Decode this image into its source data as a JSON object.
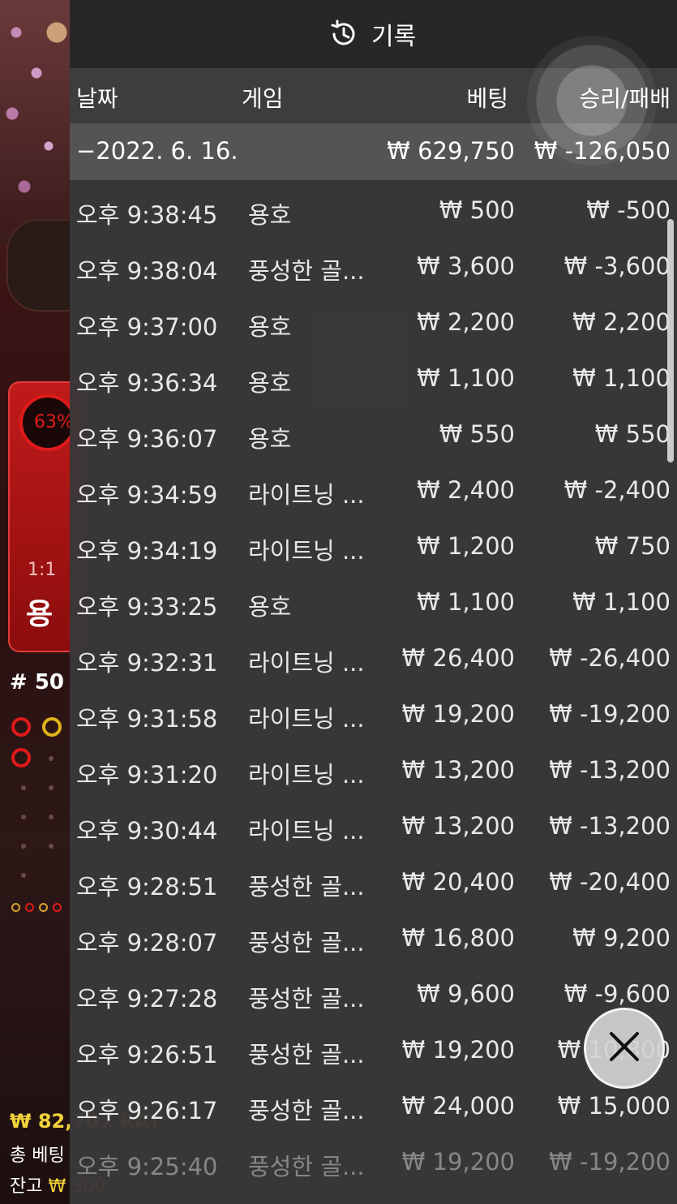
{
  "game_bg": {
    "bet_percent": "63%",
    "odds": "1:1",
    "side_label": "용",
    "round": "# 50",
    "balance": "₩ 82,707 RAT",
    "total_bet_label": "총 베팅",
    "remaining_label": "잔고",
    "remaining_value": "₩ 300"
  },
  "header": {
    "title": "기록",
    "icon": "history-icon"
  },
  "columns": {
    "date": "날짜",
    "game": "게임",
    "bet": "베팅",
    "winloss": "승리/패배"
  },
  "summary": {
    "date": "−2022. 6. 16.",
    "bet": "₩ 629,750",
    "winloss": "₩ -126,050"
  },
  "rows": [
    {
      "time": "오후 9:38:45",
      "game": "용호",
      "bet": "₩ 500",
      "winloss": "₩ -500"
    },
    {
      "time": "오후 9:38:04",
      "game": "풍성한 골...",
      "bet": "₩ 3,600",
      "winloss": "₩ -3,600"
    },
    {
      "time": "오후 9:37:00",
      "game": "용호",
      "bet": "₩ 2,200",
      "winloss": "₩ 2,200"
    },
    {
      "time": "오후 9:36:34",
      "game": "용호",
      "bet": "₩ 1,100",
      "winloss": "₩ 1,100"
    },
    {
      "time": "오후 9:36:07",
      "game": "용호",
      "bet": "₩ 550",
      "winloss": "₩ 550"
    },
    {
      "time": "오후 9:34:59",
      "game": "라이트닝 ...",
      "bet": "₩ 2,400",
      "winloss": "₩ -2,400"
    },
    {
      "time": "오후 9:34:19",
      "game": "라이트닝 ...",
      "bet": "₩ 1,200",
      "winloss": "₩ 750"
    },
    {
      "time": "오후 9:33:25",
      "game": "용호",
      "bet": "₩ 1,100",
      "winloss": "₩ 1,100"
    },
    {
      "time": "오후 9:32:31",
      "game": "라이트닝 ...",
      "bet": "₩ 26,400",
      "winloss": "₩ -26,400"
    },
    {
      "time": "오후 9:31:58",
      "game": "라이트닝 ...",
      "bet": "₩ 19,200",
      "winloss": "₩ -19,200"
    },
    {
      "time": "오후 9:31:20",
      "game": "라이트닝 ...",
      "bet": "₩ 13,200",
      "winloss": "₩ -13,200"
    },
    {
      "time": "오후 9:30:44",
      "game": "라이트닝 ...",
      "bet": "₩ 13,200",
      "winloss": "₩ -13,200"
    },
    {
      "time": "오후 9:28:51",
      "game": "풍성한 골...",
      "bet": "₩ 20,400",
      "winloss": "₩ -20,400"
    },
    {
      "time": "오후 9:28:07",
      "game": "풍성한 골...",
      "bet": "₩ 16,800",
      "winloss": "₩ 9,200"
    },
    {
      "time": "오후 9:27:28",
      "game": "풍성한 골...",
      "bet": "₩ 9,600",
      "winloss": "₩ -9,600"
    },
    {
      "time": "오후 9:26:51",
      "game": "풍성한 골...",
      "bet": "₩ 19,200",
      "winloss": "₩ 10,800"
    },
    {
      "time": "오후 9:26:17",
      "game": "풍성한 골...",
      "bet": "₩ 24,000",
      "winloss": "₩ 15,000"
    },
    {
      "time": "오후 9:25:40",
      "game": "풍성한 골...",
      "bet": "₩ 19,200",
      "winloss": "₩ -19,200"
    }
  ],
  "close_icon": "close-icon"
}
